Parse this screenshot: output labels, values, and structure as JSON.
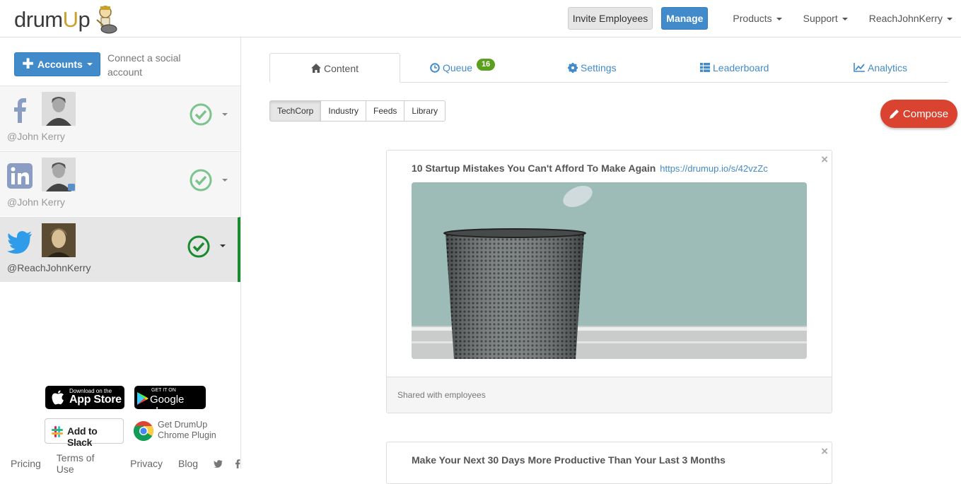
{
  "brand": {
    "logo_prefix": "drum",
    "logo_u": "U",
    "logo_suffix": "p"
  },
  "nav": {
    "invite_label": "Invite Employees",
    "manage_label": "Manage",
    "products_label": "Products",
    "support_label": "Support",
    "user_label": "ReachJohnKerry"
  },
  "sidebar": {
    "accounts_label": "Accounts",
    "connect_text": "Connect a social account",
    "accounts": [
      {
        "network": "facebook",
        "handle": "@John Kerry"
      },
      {
        "network": "linkedin",
        "handle": "@John Kerry"
      },
      {
        "network": "twitter",
        "handle": "@ReachJohnKerry"
      }
    ],
    "app_store": {
      "small": "Download on the",
      "big": "App Store"
    },
    "google_play": {
      "small": "GET IT ON",
      "big": "Google play"
    },
    "slack": {
      "label": "Add to Slack"
    },
    "chrome": {
      "line1": "Get DrumUp",
      "line2": "Chrome Plugin"
    },
    "footer": {
      "pricing": "Pricing",
      "terms": "Terms of Use",
      "privacy": "Privacy",
      "blog": "Blog"
    }
  },
  "tabs": {
    "content": "Content",
    "queue": "Queue",
    "queue_count": "16",
    "settings": "Settings",
    "leaderboard": "Leaderboard",
    "analytics": "Analytics"
  },
  "subtabs": [
    "TechCorp",
    "Industry",
    "Feeds",
    "Library"
  ],
  "compose_label": "Compose",
  "posts": [
    {
      "title": "10 Startup Mistakes You Can't Afford To Make Again",
      "link": "https://drumup.io/s/42vzZc",
      "footer": "Shared with employees"
    },
    {
      "title": "Make Your Next 30 Days More Productive Than Your Last 3 Months"
    }
  ],
  "colors": {
    "primary": "#428bca",
    "compose": "#d9432f",
    "active_border": "#1a8a2f",
    "queue_badge": "#5a9f1e"
  }
}
